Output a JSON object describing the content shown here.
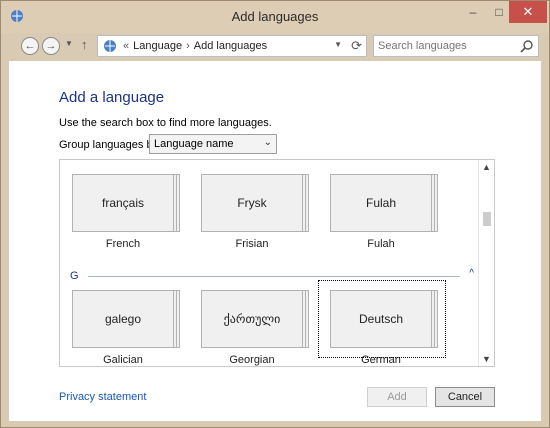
{
  "window": {
    "title": "Add languages",
    "controls": {
      "minimize": "–",
      "maximize": "□",
      "close": "✕"
    }
  },
  "navigation": {
    "back_icon": "back-arrow-icon",
    "forward_icon": "forward-arrow-icon",
    "up_icon": "up-arrow-icon",
    "breadcrumb_prefix": "«",
    "breadcrumb": [
      "Language",
      "Add languages"
    ],
    "breadcrumb_separator": "›",
    "search_placeholder": "Search languages"
  },
  "content": {
    "heading": "Add a language",
    "instructions": "Use the search box to find more languages.",
    "group_label": "Group languages by:",
    "group_by_value": "Language name",
    "language_groups": [
      {
        "letter": "",
        "languages": [
          {
            "native": "français",
            "english": "French"
          },
          {
            "native": "Frysk",
            "english": "Frisian"
          },
          {
            "native": "Fulah",
            "english": "Fulah"
          }
        ]
      },
      {
        "letter": "G",
        "collapse_icon": "^",
        "languages": [
          {
            "native": "galego",
            "english": "Galician"
          },
          {
            "native": "ქართული",
            "english": "Georgian"
          },
          {
            "native": "Deutsch",
            "english": "German"
          }
        ]
      }
    ]
  },
  "footer": {
    "privacy_link": "Privacy statement",
    "add_button": "Add",
    "cancel_button": "Cancel"
  },
  "colors": {
    "heading": "#1e3287",
    "link": "#1a58b3",
    "titlebar": "#decdb5",
    "close_button": "#c7504a"
  }
}
